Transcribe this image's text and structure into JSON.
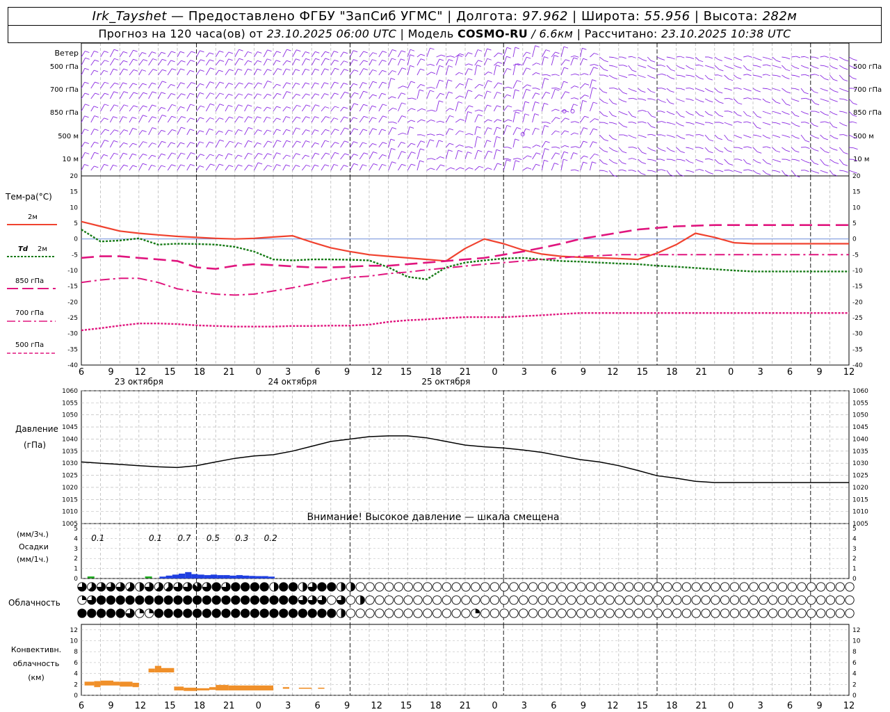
{
  "header": {
    "station": "Irk_Tayshet",
    "provider": "— Предоставлено ФГБУ \"ЗапСиб УГМС\" |",
    "lon_label": "Долгота:",
    "lon_value": "97.962",
    "lat_label": "| Широта:",
    "lat_value": "55.956",
    "alt_label": "| Высота:",
    "alt_value": "282м",
    "forecast_label": "Прогноз на 120 часа(ов) от",
    "forecast_start": "23.10.2025 06:00 UTC",
    "model_label": "| Модель",
    "model_name": "COSMO-RU",
    "model_res": "/ 6.6км",
    "calc_label": "| Рассчитано:",
    "calc_time": "23.10.2025 10:38 UTC"
  },
  "wind_panel": {
    "levels": [
      "Ветер",
      "500 гПа",
      "700 гПа",
      "850 гПа",
      "500 м",
      "10  м"
    ],
    "right_levels": [
      "500 гПа",
      "700 гПа",
      "850 гПа",
      "500 м",
      "10  м"
    ],
    "barb_color": "#8b2be2"
  },
  "time_axis": {
    "hours": [
      "6",
      "9",
      "12",
      "15",
      "18",
      "21",
      "0",
      "3",
      "6",
      "9",
      "12",
      "15",
      "18",
      "21",
      "0",
      "3",
      "6",
      "9",
      "12",
      "15",
      "18",
      "21",
      "0",
      "3",
      "6",
      "9",
      "12"
    ],
    "dates": [
      "23 октября",
      "24 октября",
      "25 октября"
    ]
  },
  "legend": {
    "temp_title": "Тем-ра(°C)",
    "t2m": "2м",
    "td_prefix": "Td",
    "td_suffix": "2м",
    "t850": "850 гПа",
    "t700": "700 гПа",
    "t500": "500 гПа",
    "pressure_title": "Давление",
    "pressure_unit": "(гПа)",
    "precip_unit3": "(мм/3ч.)",
    "precip_title": "Осадки",
    "precip_unit1": "(мм/1ч.)",
    "cloud_title": "Облачность",
    "conv_title1": "Конвективн.",
    "conv_title2": "облачность",
    "conv_unit": "(км)"
  },
  "warning": "Внимание! Высокое давление — шкала смещена",
  "colors": {
    "t2m": "#f0422f",
    "td": "#157a15",
    "t850": "#e0157e",
    "precip3": "#20b020",
    "precip1": "#1f3fe0",
    "convective": "#f0902a",
    "grid": "#b0b0b0"
  },
  "chart_data": [
    {
      "type": "line",
      "ylim": [
        -40,
        20
      ],
      "yticks": [
        20,
        15,
        10,
        5,
        0,
        -5,
        -10,
        -15,
        -20,
        -25,
        -30,
        -35,
        -40
      ],
      "x_hours_from_start": [
        0,
        3,
        6,
        9,
        12,
        15,
        18,
        21,
        24,
        27,
        30,
        33,
        36,
        39,
        42,
        45,
        48,
        51,
        54,
        57,
        60,
        63,
        66,
        69,
        72,
        75,
        78,
        81,
        84,
        87,
        90,
        93,
        96,
        99,
        102,
        105,
        108,
        111,
        114,
        117,
        120
      ],
      "series": [
        {
          "name": "2м",
          "values": [
            5.5,
            4,
            2.5,
            1.8,
            1.3,
            0.8,
            0.5,
            0.2,
            0,
            0.2,
            0.6,
            1,
            -1,
            -2.8,
            -4,
            -5,
            -5.5,
            -6,
            -6.5,
            -7,
            -3,
            0,
            -1.5,
            -3.5,
            -4.8,
            -5.5,
            -5.8,
            -6,
            -6.2,
            -6.5,
            -4.5,
            -1.8,
            1.8,
            0.5,
            -1.2,
            -1.5,
            -1.5,
            -1.5,
            -1.5,
            -1.5,
            -1.5
          ]
        },
        {
          "name": "Td 2м",
          "values": [
            3,
            -0.8,
            -0.5,
            0.2,
            -1.8,
            -1.5,
            -1.6,
            -1.8,
            -2.5,
            -4,
            -6.5,
            -6.8,
            -6.5,
            -6.5,
            -6.6,
            -6.8,
            -9,
            -12,
            -12.8,
            -9,
            -7.5,
            -6.8,
            -6.2,
            -6,
            -6.5,
            -7,
            -7.2,
            -7.5,
            -7.8,
            -8,
            -8.5,
            -8.8,
            -9.2,
            -9.6,
            -10,
            -10.3,
            -10.3,
            -10.3,
            -10.3,
            -10.3,
            -10.3
          ]
        },
        {
          "name": "850 гПа",
          "values": [
            -6,
            -5.5,
            -5.5,
            -6,
            -6.5,
            -7,
            -9,
            -9.5,
            -8.5,
            -8,
            -8.3,
            -8.7,
            -9,
            -9,
            -8.8,
            -8.5,
            -8.5,
            -8,
            -7.5,
            -7,
            -6.5,
            -6,
            -5,
            -4,
            -2.8,
            -1.5,
            0,
            1,
            2,
            3,
            3.5,
            4,
            4.2,
            4.4,
            4.4,
            4.4,
            4.4,
            4.4,
            4.4,
            4.4,
            4.4
          ]
        },
        {
          "name": "700 гПа",
          "values": [
            -13.8,
            -13,
            -12.5,
            -12.5,
            -13.8,
            -15.8,
            -16.8,
            -17.5,
            -17.8,
            -17.5,
            -16.5,
            -15.5,
            -14.3,
            -13,
            -12.2,
            -11.8,
            -11,
            -10.5,
            -9.8,
            -9.2,
            -8.6,
            -8,
            -7.5,
            -7,
            -6.5,
            -6,
            -5.5,
            -5.3,
            -5,
            -5,
            -5,
            -5,
            -5,
            -5,
            -5,
            -5,
            -5,
            -5,
            -5,
            -5,
            -5
          ]
        },
        {
          "name": "500 гПа",
          "values": [
            -29,
            -28.3,
            -27.5,
            -26.8,
            -26.8,
            -27,
            -27.4,
            -27.6,
            -27.8,
            -27.8,
            -27.8,
            -27.6,
            -27.6,
            -27.5,
            -27.5,
            -27.2,
            -26.3,
            -25.8,
            -25.5,
            -25.1,
            -24.8,
            -24.8,
            -24.8,
            -24.5,
            -24.2,
            -23.8,
            -23.5,
            -23.5,
            -23.5,
            -23.5,
            -23.5,
            -23.5,
            -23.5,
            -23.5,
            -23.5,
            -23.5,
            -23.5,
            -23.5,
            -23.5,
            -23.5,
            -23.5
          ]
        }
      ]
    },
    {
      "type": "line",
      "ylim": [
        1005,
        1060
      ],
      "yticks": [
        1060,
        1055,
        1050,
        1045,
        1040,
        1035,
        1030,
        1025,
        1020,
        1015,
        1010,
        1005
      ],
      "x_hours_from_start": [
        0,
        3,
        6,
        9,
        12,
        15,
        18,
        21,
        24,
        27,
        30,
        33,
        36,
        39,
        42,
        45,
        48,
        51,
        54,
        57,
        60,
        63,
        66,
        69,
        72,
        75,
        78,
        81,
        84,
        87,
        90,
        93,
        96,
        99,
        102,
        105,
        108,
        111,
        114,
        117,
        120
      ],
      "series": [
        {
          "name": "Давление",
          "values": [
            1030.5,
            1030,
            1029.5,
            1029,
            1028.5,
            1028.2,
            1029,
            1030.5,
            1032,
            1033,
            1033.5,
            1035,
            1037,
            1039,
            1040,
            1041,
            1041.3,
            1041.3,
            1040.5,
            1039,
            1037.5,
            1036.8,
            1036.3,
            1035.5,
            1034.5,
            1033,
            1031.5,
            1030.5,
            1029,
            1027,
            1024.8,
            1023.8,
            1022.5,
            1022,
            1022,
            1022,
            1022,
            1022,
            1022,
            1022,
            1022
          ]
        }
      ]
    },
    {
      "type": "bar",
      "ylim": [
        0,
        5
      ],
      "yticks": [
        5,
        4,
        3,
        2,
        1,
        0
      ],
      "totals_3h": [
        {
          "hour": 1.5,
          "label": "0.1"
        },
        {
          "hour": 10.5,
          "label": "0.1"
        },
        {
          "hour": 15,
          "label": "0.7"
        },
        {
          "hour": 19.5,
          "label": "0.5"
        },
        {
          "hour": 24,
          "label": "0.3"
        },
        {
          "hour": 28.5,
          "label": "0.2"
        }
      ],
      "series": [
        {
          "name": "3ч",
          "x": [
            1.5,
            10.5
          ],
          "values": [
            0.1,
            0.1
          ]
        },
        {
          "name": "1ч",
          "x": [
            12,
            13,
            14,
            15,
            16,
            17,
            18,
            19,
            20,
            21,
            22,
            23,
            24,
            25,
            26,
            27,
            28,
            29
          ],
          "values": [
            0.05,
            0.15,
            0.25,
            0.35,
            0.5,
            0.3,
            0.25,
            0.2,
            0.25,
            0.2,
            0.2,
            0.15,
            0.2,
            0.15,
            0.12,
            0.1,
            0.1,
            0.05
          ]
        }
      ]
    },
    {
      "type": "heatmap",
      "rows": [
        "верхний ярус",
        "средний ярус",
        "нижний ярус"
      ],
      "x_hours_from_start_step": 1.5,
      "cover_eighths": [
        [
          6,
          5,
          6,
          6,
          6,
          5,
          4,
          6,
          5,
          5,
          6,
          6,
          7,
          6,
          8,
          6,
          8,
          8,
          8,
          8,
          4,
          8,
          8,
          4,
          6,
          8,
          8,
          4,
          4,
          0,
          0,
          0,
          0,
          0,
          0,
          0,
          0,
          0,
          0,
          0,
          0,
          0,
          0,
          0,
          0,
          0,
          0,
          0,
          0,
          0,
          0,
          0,
          0,
          0,
          0,
          0,
          0,
          0,
          0,
          0,
          0,
          0,
          0,
          0,
          0,
          0,
          0,
          0,
          0,
          0,
          0,
          0,
          0,
          0,
          0,
          0,
          0,
          0,
          0,
          0,
          0
        ],
        [
          2,
          6,
          8,
          8,
          8,
          8,
          8,
          8,
          8,
          8,
          8,
          8,
          8,
          8,
          8,
          8,
          8,
          8,
          8,
          8,
          8,
          8,
          8,
          6,
          6,
          6,
          0,
          6,
          0,
          4,
          0,
          0,
          0,
          0,
          0,
          0,
          0,
          0,
          0,
          0,
          0,
          0,
          0,
          0,
          0,
          0,
          0,
          0,
          0,
          0,
          0,
          0,
          0,
          0,
          0,
          0,
          0,
          0,
          0,
          0,
          0,
          0,
          0,
          0,
          0,
          0,
          0,
          0,
          0,
          0,
          0,
          0,
          0,
          0,
          0,
          0,
          0,
          0,
          0,
          0,
          0
        ],
        [
          8,
          8,
          8,
          8,
          8,
          6,
          2,
          2,
          8,
          8,
          8,
          8,
          8,
          8,
          8,
          8,
          8,
          8,
          8,
          8,
          8,
          8,
          8,
          8,
          8,
          8,
          8,
          4,
          0,
          0,
          0,
          0,
          0,
          0,
          0,
          0,
          0,
          0,
          0,
          0,
          0,
          2,
          0,
          0,
          0,
          0,
          0,
          0,
          0,
          0,
          0,
          0,
          0,
          0,
          0,
          0,
          0,
          0,
          0,
          0,
          0,
          0,
          0,
          0,
          0,
          0,
          0,
          0,
          0,
          0,
          0,
          0,
          0,
          0,
          0,
          0,
          0,
          0,
          0,
          0,
          0
        ]
      ]
    },
    {
      "type": "bar",
      "ylim": [
        0,
        13
      ],
      "yticks": [
        12,
        10,
        8,
        6,
        4,
        2,
        0
      ],
      "series": [
        {
          "name": "Конвективная облачность",
          "segments": [
            {
              "h0": 0.5,
              "h1": 2,
              "bottom": 1.8,
              "top": 2.5
            },
            {
              "h0": 2,
              "h1": 3,
              "bottom": 1.5,
              "top": 2.6
            },
            {
              "h0": 3,
              "h1": 5,
              "bottom": 1.8,
              "top": 2.7
            },
            {
              "h0": 5,
              "h1": 6,
              "bottom": 1.8,
              "top": 2.5
            },
            {
              "h0": 6,
              "h1": 8,
              "bottom": 1.6,
              "top": 2.5
            },
            {
              "h0": 8,
              "h1": 9,
              "bottom": 1.5,
              "top": 2.3
            },
            {
              "h0": 10.5,
              "h1": 11.5,
              "bottom": 4.2,
              "top": 4.9
            },
            {
              "h0": 11.5,
              "h1": 12.5,
              "bottom": 4.2,
              "top": 5.4
            },
            {
              "h0": 12.5,
              "h1": 14.5,
              "bottom": 4.2,
              "top": 5.0
            },
            {
              "h0": 14.5,
              "h1": 16,
              "bottom": 0.9,
              "top": 1.6
            },
            {
              "h0": 16,
              "h1": 18,
              "bottom": 0.8,
              "top": 1.4
            },
            {
              "h0": 18,
              "h1": 20,
              "bottom": 0.9,
              "top": 1.3
            },
            {
              "h0": 20,
              "h1": 21,
              "bottom": 1.0,
              "top": 1.5
            },
            {
              "h0": 21,
              "h1": 23,
              "bottom": 0.9,
              "top": 1.9
            },
            {
              "h0": 23,
              "h1": 30,
              "bottom": 0.9,
              "top": 1.8
            },
            {
              "h0": 31.5,
              "h1": 32.5,
              "bottom": 1.2,
              "top": 1.5
            },
            {
              "h0": 34,
              "h1": 36,
              "bottom": 1.2,
              "top": 1.4
            },
            {
              "h0": 37,
              "h1": 38,
              "bottom": 1.2,
              "top": 1.4
            }
          ]
        }
      ]
    }
  ]
}
